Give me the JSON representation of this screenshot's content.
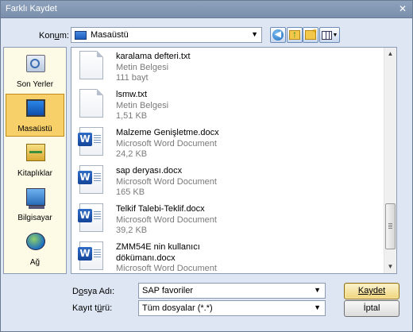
{
  "window": {
    "title": "Farklı Kaydet",
    "close_glyph": "✕"
  },
  "location": {
    "label_before": "Kon",
    "label_underlined": "u",
    "label_after": "m:",
    "value": "Masaüstü"
  },
  "toolbar": {
    "back_icon": "back-icon",
    "up_icon": "up-folder-icon",
    "new_folder_icon": "new-folder-icon",
    "view_icon": "view-menu-icon"
  },
  "places": [
    {
      "label": "Son Yerler",
      "icon": "recent-places-icon",
      "active": false
    },
    {
      "label": "Masaüstü",
      "icon": "desktop-icon",
      "active": true
    },
    {
      "label": "Kitaplıklar",
      "icon": "libraries-icon",
      "active": false
    },
    {
      "label": "Bilgisayar",
      "icon": "computer-icon",
      "active": false
    },
    {
      "label": "Ağ",
      "icon": "network-icon",
      "active": false
    }
  ],
  "files": [
    {
      "name": "karalama defteri.txt",
      "type": "Metin Belgesi",
      "size": "111 bayt",
      "kind": "txt"
    },
    {
      "name": "lsmw.txt",
      "type": "Metin Belgesi",
      "size": "1,51 KB",
      "kind": "txt"
    },
    {
      "name": "Malzeme Genişletme.docx",
      "type": "Microsoft Word Document",
      "size": "24,2 KB",
      "kind": "docx"
    },
    {
      "name": "sap deryası.docx",
      "type": "Microsoft Word Document",
      "size": "165 KB",
      "kind": "docx"
    },
    {
      "name": "Telkif Talebi-Teklif.docx",
      "type": "Microsoft Word Document",
      "size": "39,2 KB",
      "kind": "docx"
    },
    {
      "name": "ZMM54E nin kullanıcı",
      "name2": "dökümanı.docx",
      "type": "Microsoft Word Document",
      "size": "",
      "kind": "docx"
    }
  ],
  "form": {
    "filename_label_before": "D",
    "filename_label_underlined": "o",
    "filename_label_after": "sya Adı:",
    "filename_value": "SAP favoriler",
    "filetype_label_before": "Kayıt t",
    "filetype_label_underlined": "ü",
    "filetype_label_after": "rü:",
    "filetype_value": "Tüm dosyalar (*.*)"
  },
  "buttons": {
    "save": "Kaydet",
    "save_underlined_first": true,
    "cancel": "İptal"
  }
}
